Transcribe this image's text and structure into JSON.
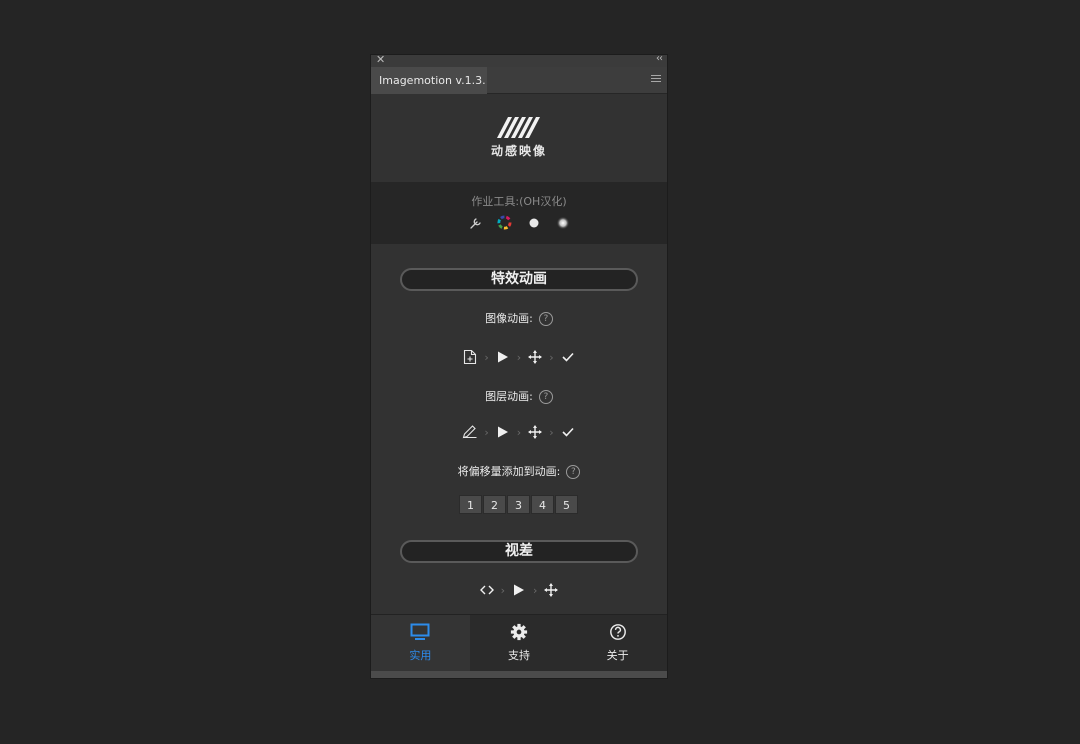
{
  "panel": {
    "close_glyph": "✕",
    "collapse_glyph": "‹‹",
    "tab_title": "Imagemotion v.1.3."
  },
  "logo": {
    "brand_cn": "动感映像"
  },
  "tools": {
    "title": "作业工具:(OH汉化)",
    "icons": [
      "wrench-icon",
      "color-wheel-icon",
      "solid-dot-icon",
      "soft-dot-icon"
    ]
  },
  "effects": {
    "header": "特效动画",
    "image_anim_label": "图像动画:",
    "layer_anim_label": "图层动画:",
    "offset_label": "将偏移量添加到动画:",
    "help_glyph": "?",
    "offsets": [
      "1",
      "2",
      "3",
      "4",
      "5"
    ]
  },
  "parallax": {
    "header": "视差"
  },
  "nav": {
    "items": [
      {
        "label": "实用",
        "icon": "monitor-icon",
        "active": true
      },
      {
        "label": "支持",
        "icon": "gear-icon",
        "active": false
      },
      {
        "label": "关于",
        "icon": "question-circle-icon",
        "active": false
      }
    ]
  },
  "colors": {
    "accent": "#2d8ceb",
    "panel_bg": "#323232",
    "page_bg": "#252525"
  }
}
